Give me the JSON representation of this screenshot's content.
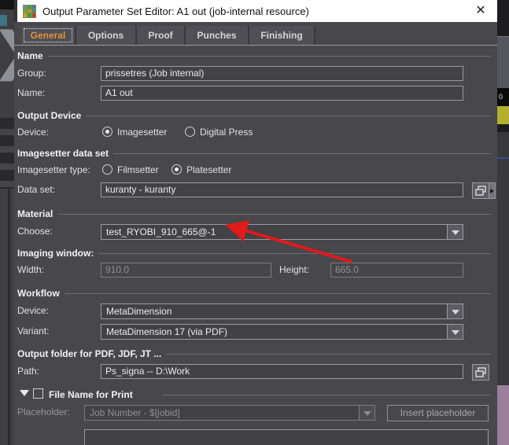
{
  "window": {
    "title": "Output Parameter Set Editor: A1 out (job-internal resource)",
    "close_glyph": "✕"
  },
  "background": {
    "right_fragment_text": "0"
  },
  "tabs": {
    "general": "General",
    "options": "Options",
    "proof": "Proof",
    "punches": "Punches",
    "finishing": "Finishing"
  },
  "sections": {
    "name": {
      "header": "Name",
      "group_label": "Group:",
      "group_value": "prissetres (Job internal)",
      "name_label": "Name:",
      "name_value": "A1 out"
    },
    "output_device": {
      "header": "Output Device",
      "device_label": "Device:",
      "option_imagesetter": "Imagesetter",
      "option_digital_press": "Digital Press",
      "selected": "Imagesetter"
    },
    "imagesetter_data_set": {
      "header": "Imagesetter data set",
      "type_label": "Imagesetter type:",
      "option_filmsetter": "Filmsetter",
      "option_platesetter": "Platesetter",
      "selected": "Platesetter",
      "data_set_label": "Data set:",
      "data_set_value": "kuranty - kuranty"
    },
    "material": {
      "header": "Material",
      "choose_label": "Choose:",
      "choose_value": "test_RYOBI_910_665@-1"
    },
    "imaging_window": {
      "header": "Imaging window:",
      "width_label": "Width:",
      "width_value": "910.0",
      "height_label": "Height:",
      "height_value": "665.0"
    },
    "workflow": {
      "header": "Workflow",
      "device_label": "Device:",
      "device_value": "MetaDimension",
      "variant_label": "Variant:",
      "variant_value": "MetaDimension 17 (via PDF)"
    },
    "output_folder": {
      "header": "Output folder for PDF, JDF, JT ...",
      "path_label": "Path:",
      "path_value": "Ps_signa -- D:\\Work"
    },
    "file_name_for_print": {
      "header": "File Name for Print",
      "placeholder_label": "Placeholder:",
      "placeholder_value": "Job Number - $[jobid]",
      "insert_button_label": "Insert placeholder",
      "file_name_value": ""
    }
  },
  "annotation": {
    "arrow_color": "#e11a1a",
    "points_to": "material choose dropdown"
  },
  "colors": {
    "dialog_bg": "#47474c",
    "titlebar_bg": "#ffffff",
    "selected_tab_text": "#e0923a",
    "field_border": "#9a9aa0",
    "accent_yellow_fragment": "#b2b02c",
    "mauve_fragment": "#9c7f9c"
  }
}
